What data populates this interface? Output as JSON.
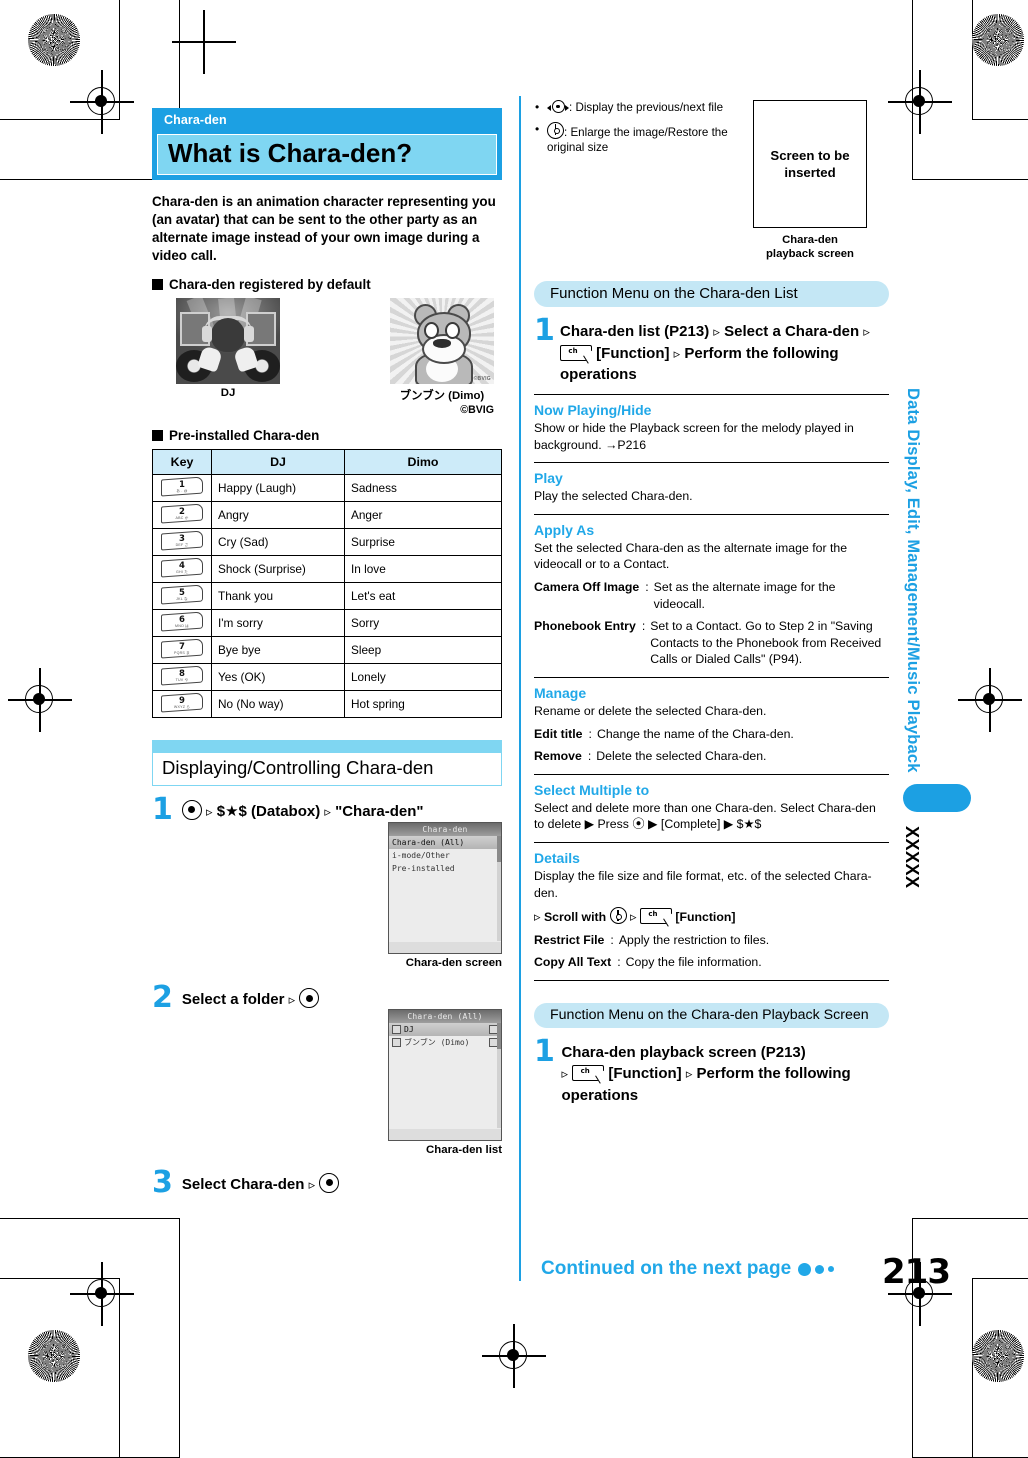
{
  "page": {
    "number": "213",
    "continued_label": "Continued on the next page",
    "side_tab_text": "Data Display, Edit, Management/Music Playback",
    "side_tab_code": "XXXXX"
  },
  "chapter": {
    "kicker": "Chara-den",
    "title": "What is Chara-den?"
  },
  "intro": {
    "paragraph": "Chara-den is an animation character representing you (an avatar) that can be sent to the other party as an alternate image instead of your own image during a video call.",
    "default_heading": "Chara-den registered by default",
    "preinstalled_heading": "Pre-installed Chara-den"
  },
  "figures": {
    "dj_caption": "DJ",
    "dimo_caption": "ブンブン (Dimo)",
    "dimo_copyright": "©BVIG",
    "dimo_watermark": "©BVIG"
  },
  "key_table": {
    "headers": [
      "Key",
      "DJ",
      "Dimo"
    ],
    "rows": [
      {
        "key": "1",
        "keysub": "あ . @",
        "dj": "Happy (Laugh)",
        "dimo": "Sadness"
      },
      {
        "key": "2",
        "keysub": "ABC か",
        "dj": "Angry",
        "dimo": "Anger"
      },
      {
        "key": "3",
        "keysub": "DEF さ",
        "dj": "Cry (Sad)",
        "dimo": "Surprise"
      },
      {
        "key": "4",
        "keysub": "GHI た",
        "dj": "Shock (Surprise)",
        "dimo": "In love"
      },
      {
        "key": "5",
        "keysub": "JKL な",
        "dj": "Thank you",
        "dimo": "Let's eat"
      },
      {
        "key": "6",
        "keysub": "MNO は",
        "dj": "I'm sorry",
        "dimo": "Sorry"
      },
      {
        "key": "7",
        "keysub": "PQRS ま",
        "dj": "Bye bye",
        "dimo": "Sleep"
      },
      {
        "key": "8",
        "keysub": "TUV や",
        "dj": "Yes (OK)",
        "dimo": "Lonely"
      },
      {
        "key": "9",
        "keysub": "WXYZ ら",
        "dj": "No (No way)",
        "dimo": "Hot spring"
      }
    ]
  },
  "section_display": {
    "heading": "Displaying/Controlling Chara-den",
    "steps": [
      {
        "num": "1",
        "text_a": "",
        "databox": "$★$ (Databox)",
        "quoted": "\"Chara-den\""
      },
      {
        "num": "2",
        "text": "Select a folder"
      },
      {
        "num": "3",
        "text": "Select Chara-den"
      }
    ],
    "shot1": {
      "title": "Chara-den",
      "rows": [
        "Chara-den (All)",
        "i-mode/Other",
        "Pre-installed"
      ],
      "caption": "Chara-den screen"
    },
    "shot2": {
      "title": "Chara-den (All)",
      "rows": [
        "DJ",
        "ブンブン (Dimo)"
      ],
      "caption": "Chara-den list"
    }
  },
  "right_bullets": [
    {
      "icon": "left-right-key-icon",
      "text": ": Display the previous/next file"
    },
    {
      "icon": "up-down-key-icon",
      "text": ": Enlarge the image/Restore the original size"
    }
  ],
  "placeholder": {
    "text": "Screen to be inserted",
    "caption_line1": "Chara-den",
    "caption_line2": "playback screen"
  },
  "function_menu_list": {
    "banner": "Function Menu on the Chara-den List",
    "step_num": "1",
    "step_part1": "Chara-den list (P213)",
    "step_part2": "Select a Chara-den",
    "step_key": "ch",
    "step_part3": "[Function]",
    "step_part4": "Perform the following operations",
    "entries": [
      {
        "name": "Now Playing/Hide",
        "desc": "Show or hide the Playback screen for the melody played in background. →P216",
        "subs": []
      },
      {
        "name": "Play",
        "desc": "Play the selected Chara-den.",
        "subs": []
      },
      {
        "name": "Apply As",
        "desc": "Set the selected Chara-den as the alternate image for the videocall or to a Contact.",
        "subs": [
          {
            "label": "Camera Off Image",
            "value": "Set as the alternate image for the videocall."
          },
          {
            "label": "Phonebook Entry",
            "value": "Set to a Contact. Go to Step 2 in \"Saving Contacts to the Phonebook from Received Calls or Dialed Calls\" (P94)."
          }
        ]
      },
      {
        "name": "Manage",
        "desc": "Rename or delete the selected Chara-den.",
        "subs": [
          {
            "label": "Edit title",
            "value": "Change the name of the Chara-den."
          },
          {
            "label": "Remove",
            "value": "Delete the selected Chara-den."
          }
        ]
      },
      {
        "name": "Select Multiple to",
        "desc": "Select and delete more than one Chara-den. Select Chara-den to delete ▶ Press ⦿ ▶ [Complete] ▶ $★$",
        "subs": []
      },
      {
        "name": "Details",
        "desc": "Display the file size and file format, etc. of the selected Chara-den.",
        "scroll_line": "Scroll with",
        "scroll_func": "[Function]",
        "subs": [
          {
            "label": "Restrict File",
            "value": "Apply the restriction to files."
          },
          {
            "label": "Copy All Text",
            "value": "Copy the file information."
          }
        ]
      }
    ]
  },
  "function_menu_playback": {
    "banner": "Function Menu on the Chara-den Playback Screen",
    "step_num": "1",
    "step_part1": "Chara-den playback screen (P213)",
    "step_key": "ch",
    "step_part2": "[Function]",
    "step_part3": "Perform the following operations"
  },
  "colors": {
    "accent": "#1CA0E3",
    "accent_light": "#7FD6F2",
    "pill": "#C4E7F5",
    "table_header": "#CDEBF9"
  }
}
